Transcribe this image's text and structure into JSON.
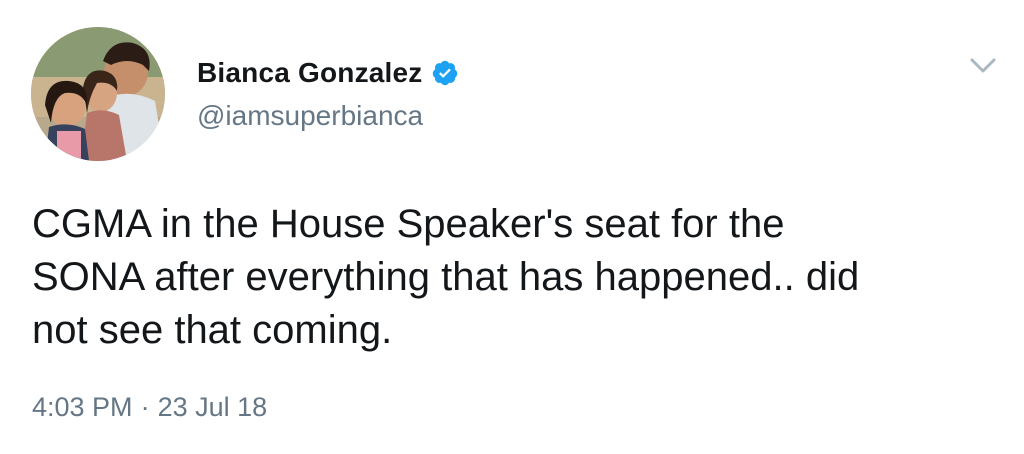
{
  "tweet": {
    "author": {
      "display_name": "Bianca Gonzalez",
      "handle": "@iamsuperbianca",
      "verified": true,
      "avatar_icon": "profile-photo"
    },
    "text": "CGMA in the House Speaker's seat for the\nSONA after everything that has happened.. did\nnot see that coming.",
    "time": "4:03 PM",
    "separator": "·",
    "date": "23 Jul 18",
    "menu_icon": "chevron-down-icon"
  },
  "colors": {
    "text_primary": "#14171a",
    "text_secondary": "#657786",
    "verified_blue": "#1da1f2",
    "chevron": "#aab8c2"
  }
}
